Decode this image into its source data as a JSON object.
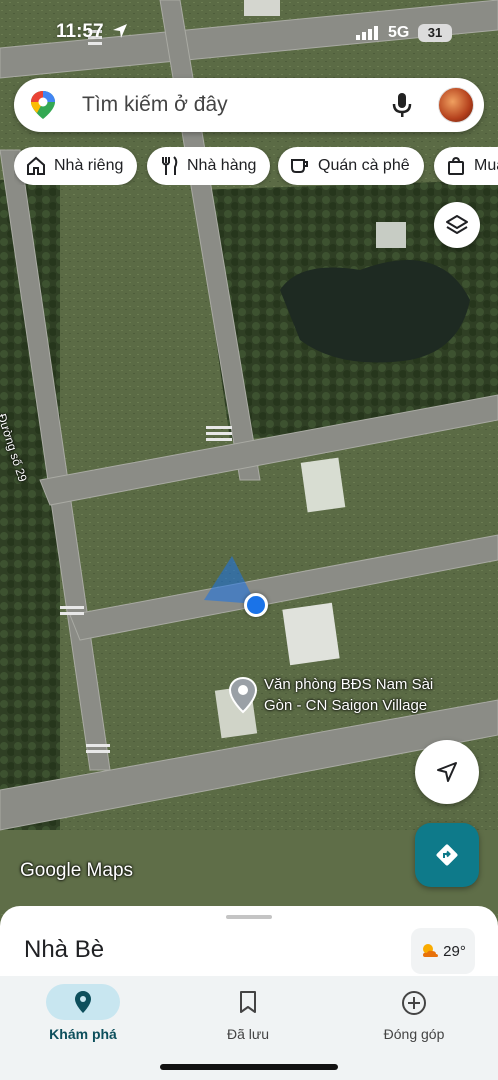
{
  "status_bar": {
    "time": "11:57",
    "network": "5G",
    "battery": "31"
  },
  "search": {
    "placeholder": "Tìm kiếm ở đây"
  },
  "chips": [
    {
      "label": "Nhà riêng",
      "icon": "home-icon"
    },
    {
      "label": "Nhà hàng",
      "icon": "restaurant-icon"
    },
    {
      "label": "Quán cà phê",
      "icon": "coffee-icon"
    },
    {
      "label": "Mua",
      "icon": "shopping-bag-icon"
    }
  ],
  "map": {
    "street_label": "Đường số 29",
    "place_name": "Văn phòng BĐS Nam Sài Gòn - CN Saigon Village",
    "watermark": "Google Maps"
  },
  "sheet": {
    "title": "Nhà Bè",
    "weather": "29°",
    "weather_icon": "partly-cloudy-icon"
  },
  "bottom_nav": [
    {
      "label": "Khám phá",
      "icon": "explore-pin-icon",
      "active": true
    },
    {
      "label": "Đã lưu",
      "icon": "bookmark-icon",
      "active": false
    },
    {
      "label": "Đóng góp",
      "icon": "add-circle-icon",
      "active": false
    }
  ],
  "colors": {
    "accent": "#0e7a8a",
    "location_blue": "#1a73e8",
    "active_pill": "#c8e6f0"
  }
}
